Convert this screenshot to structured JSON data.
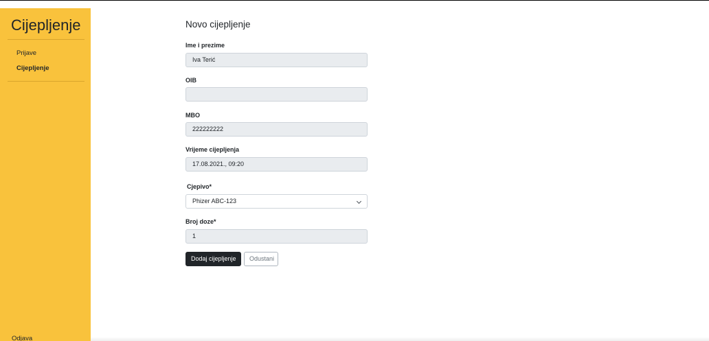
{
  "sidebar": {
    "brand": "Cijepljenje",
    "items": [
      {
        "label": "Prijave"
      },
      {
        "label": "Cijepljenje"
      }
    ],
    "logout_label": "Odjava"
  },
  "form": {
    "title": "Novo cijepljenje",
    "name": {
      "label": "Ime i prezime",
      "value": "Iva Terić"
    },
    "oib": {
      "label": "OIB",
      "value": ""
    },
    "mbo": {
      "label": "MBO",
      "value": "222222222"
    },
    "time": {
      "label": "Vrijeme cijepljenja",
      "value": "17.08.2021., 09:20"
    },
    "vaccine": {
      "label": "Cjepivo*",
      "value": "Phizer ABC-123"
    },
    "dose": {
      "label": "Broj doze*",
      "value": "1"
    },
    "submit_label": "Dodaj cijepljenje",
    "cancel_label": "Odustani"
  },
  "icons": {
    "dropdown": "chevron-down-icon"
  }
}
